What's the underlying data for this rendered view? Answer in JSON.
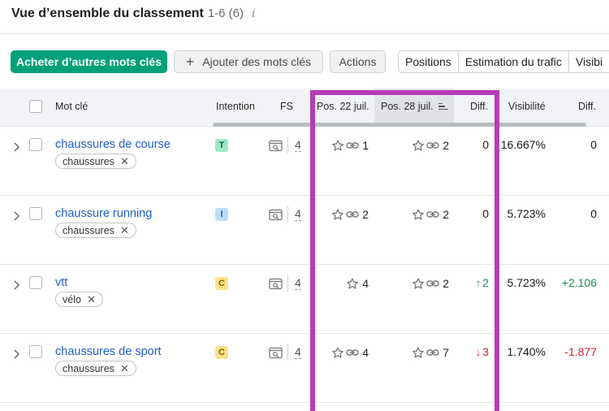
{
  "header": {
    "title": "Vue d’ensemble du classement",
    "count": "1-6 (6)",
    "info_icon": "i"
  },
  "toolbar": {
    "buy_label": "Acheter d’autres mots clés",
    "add_label": "Ajouter des mots clés",
    "actions_label": "Actions",
    "segments": [
      "Positions",
      "Estimation du trafic",
      "Visibi"
    ]
  },
  "columns": {
    "keyword": "Mot clé",
    "intent": "Intention",
    "fs": "FS",
    "pos1": "Pos. 22 juil.",
    "pos2": "Pos. 28 juil.",
    "diff": "Diff.",
    "visibility": "Visibilité",
    "diff2": "Diff."
  },
  "rows": [
    {
      "keyword": "chaussures de course",
      "tag": "chaussures",
      "intent": "T",
      "fs": "4",
      "pos1": "1",
      "pos1_link": true,
      "pos2": "2",
      "pos2_link": true,
      "diff": "0",
      "diff_dir": "none",
      "visibility": "16.667%",
      "diff2": "0",
      "diff2_dir": "none"
    },
    {
      "keyword": "chaussure running",
      "tag": "chaussures",
      "intent": "I",
      "fs": "4",
      "pos1": "2",
      "pos1_link": true,
      "pos2": "2",
      "pos2_link": true,
      "diff": "0",
      "diff_dir": "none",
      "visibility": "5.723%",
      "diff2": "0",
      "diff2_dir": "none"
    },
    {
      "keyword": "vtt",
      "tag": "vélo",
      "intent": "C",
      "fs": "4",
      "pos1": "4",
      "pos1_link": false,
      "pos2": "2",
      "pos2_link": true,
      "diff": "2",
      "diff_dir": "up",
      "visibility": "5.723%",
      "diff2": "+2.106",
      "diff2_dir": "up"
    },
    {
      "keyword": "chaussures de sport",
      "tag": "chaussures",
      "intent": "C",
      "fs": "4",
      "pos1": "4",
      "pos1_link": true,
      "pos2": "7",
      "pos2_link": true,
      "diff": "3",
      "diff_dir": "down",
      "visibility": "1.740%",
      "diff2": "-1.877",
      "diff2_dir": "down"
    }
  ],
  "colors": {
    "accent": "#00a17a",
    "link": "#1e60c4",
    "highlight": "#b73bb8",
    "up": "#1a8f5a",
    "down": "#d41e2a"
  },
  "icons": [
    "info-icon",
    "plus-icon",
    "chevron-right-icon",
    "checkbox",
    "serp-feature-icon",
    "star-icon",
    "link-icon",
    "sort-icon",
    "close-icon",
    "arrow-up-icon",
    "arrow-down-icon"
  ]
}
